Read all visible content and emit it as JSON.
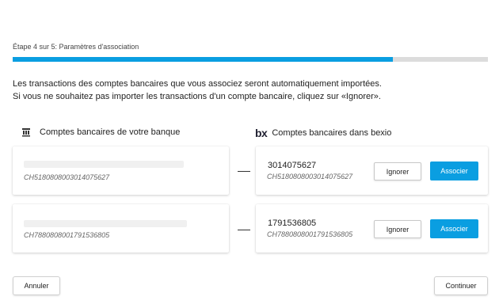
{
  "wizard": {
    "step_label": "Étape 4 sur 5: Paramètres d'association",
    "progress_fraction": 0.8
  },
  "intro": {
    "line1": "Les transactions des comptes bancaires que vous associez seront automatiquement importées.",
    "line2": "Si vous ne souhaitez pas importer les transactions d'un compte bancaire, cliquez sur «Ignorer»."
  },
  "columns": {
    "bank_title": "Comptes bancaires de votre banque",
    "bank_icon": "bank-building-icon",
    "bexio_title": "Comptes bancaires dans bexio",
    "bexio_logo": "bx"
  },
  "rows": [
    {
      "bank_iban": "CH5180808003014075627",
      "bexio_account": "3014075627",
      "bexio_iban": "CH5180808003014075627",
      "ignore_label": "Ignorer",
      "associate_label": "Associer"
    },
    {
      "bank_iban": "CH7880808001791536805",
      "bexio_account": "1791536805",
      "bexio_iban": "CH7880808001791536805",
      "ignore_label": "Ignorer",
      "associate_label": "Associer"
    }
  ],
  "footer": {
    "cancel_label": "Annuler",
    "continue_label": "Continuer"
  },
  "colors": {
    "accent": "#0a9ee1",
    "progress_track": "#dcdcdc"
  }
}
